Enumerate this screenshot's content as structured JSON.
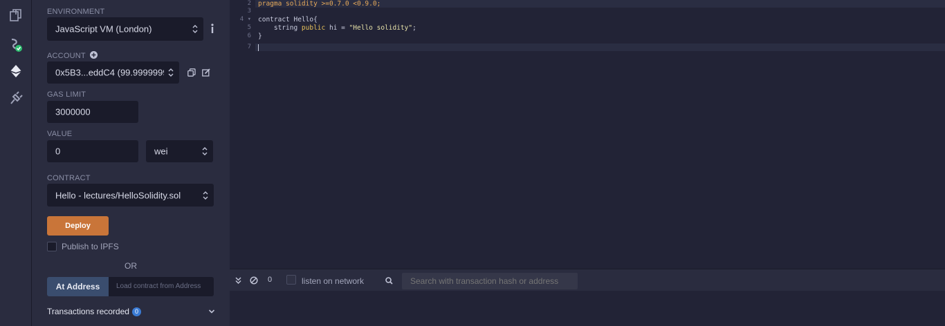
{
  "panel": {
    "environment": {
      "label": "ENVIRONMENT",
      "value": "JavaScript VM (London)"
    },
    "account": {
      "label": "ACCOUNT",
      "value": "0x5B3...eddC4 (99.9999999"
    },
    "gas_limit": {
      "label": "GAS LIMIT",
      "value": "3000000"
    },
    "value": {
      "label": "VALUE",
      "amount": "0",
      "unit": "wei"
    },
    "contract": {
      "label": "CONTRACT",
      "value": "Hello - lectures/HelloSolidity.sol"
    },
    "deploy_label": "Deploy",
    "publish_label": "Publish to IPFS",
    "or_label": "OR",
    "at_address_label": "At Address",
    "at_address_placeholder": "Load contract from Address",
    "transactions_label": "Transactions recorded",
    "transactions_count": "0"
  },
  "editor": {
    "lines": [
      {
        "num": "2",
        "fold": "",
        "segments": [
          {
            "t": "pragma solidity ",
            "c": "#e6a95a"
          },
          {
            "t": ">=0.7.0 <0.9.0;",
            "c": "#e6a95a"
          }
        ]
      },
      {
        "num": "3",
        "fold": "",
        "segments": []
      },
      {
        "num": "4",
        "fold": "▾",
        "segments": [
          {
            "t": "contract ",
            "c": "#c9ccde"
          },
          {
            "t": "Hello{",
            "c": "#c9ccde"
          }
        ]
      },
      {
        "num": "5",
        "fold": "",
        "segments": [
          {
            "t": "    string ",
            "c": "#c9ccde"
          },
          {
            "t": "public",
            "c": "#e6c15a"
          },
          {
            "t": " hi = ",
            "c": "#c9ccde"
          },
          {
            "t": "\"Hello solidity\"",
            "c": "#e6e0a8"
          },
          {
            "t": ";",
            "c": "#c9ccde"
          }
        ]
      },
      {
        "num": "6",
        "fold": "",
        "segments": [
          {
            "t": "}",
            "c": "#c9ccde"
          }
        ]
      },
      {
        "num": "7",
        "fold": "",
        "segments": []
      }
    ]
  },
  "terminal": {
    "count": "0",
    "listen_label": "listen on network",
    "search_placeholder": "Search with transaction hash or address"
  },
  "colors": {
    "accent": "#c97539",
    "badge": "#3a7bd5",
    "checkmark": "#2fbf71"
  }
}
